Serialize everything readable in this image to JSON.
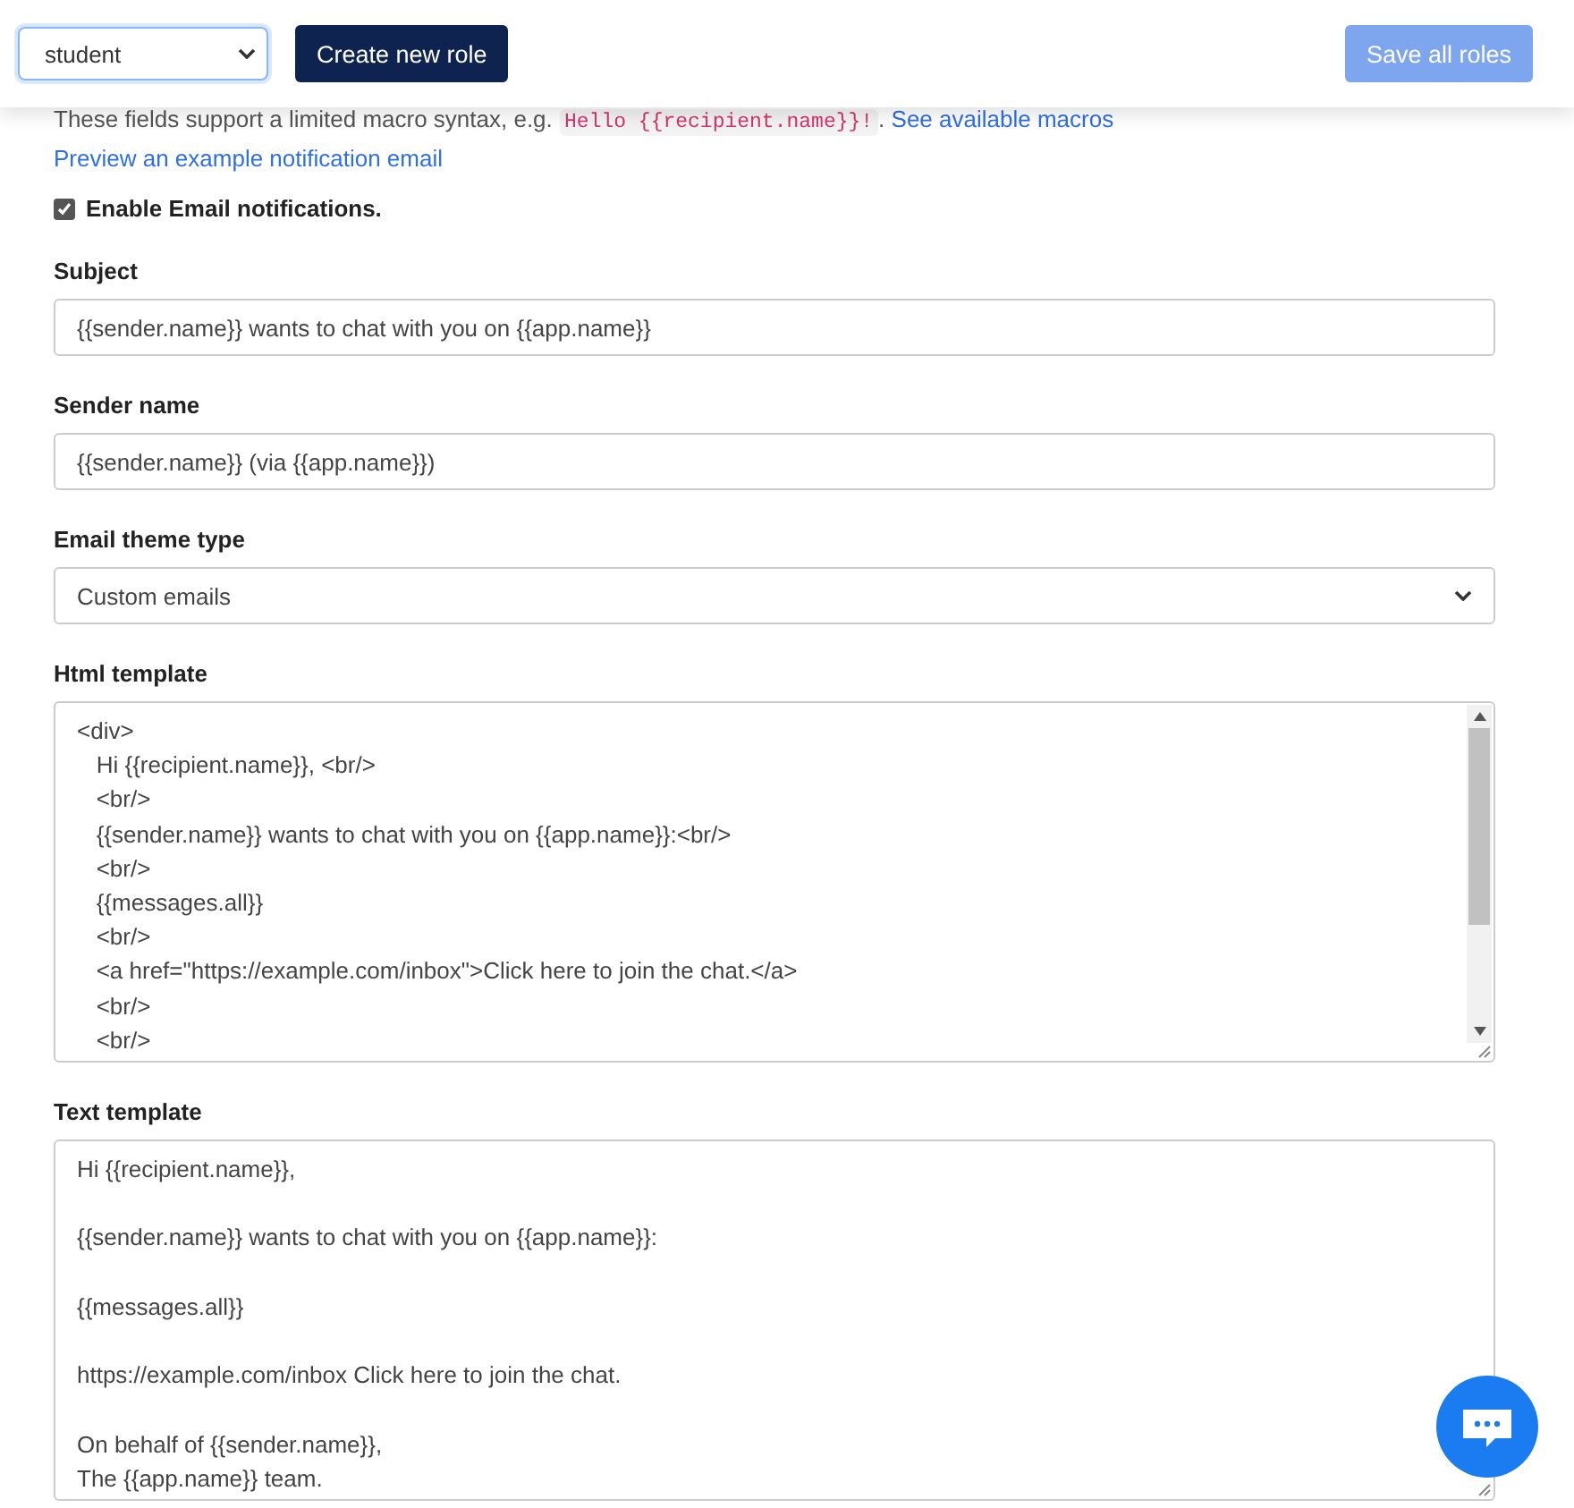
{
  "toolbar": {
    "role_select": {
      "value": "student"
    },
    "create_button": "Create new role",
    "save_button": {
      "label": "Save all roles",
      "disabled": true
    }
  },
  "hint": {
    "text": "These fields support a limited macro syntax, e.g.",
    "code": "Hello {{recipient.name}}!",
    "separator": ".",
    "link": "See available macros"
  },
  "preview_link": "Preview an example notification email",
  "enable_email": {
    "label": "Enable Email notifications.",
    "checked": true
  },
  "fields": [
    {
      "kind": "input",
      "label": "Subject",
      "value": "{{sender.name}} wants to chat with you on {{app.name}}"
    },
    {
      "kind": "input",
      "label": "Sender name",
      "value": "{{sender.name}} (via {{app.name}})"
    },
    {
      "kind": "select",
      "label": "Email theme type",
      "value": "Custom emails"
    },
    {
      "kind": "textarea",
      "label": "Html template",
      "scrollable": true,
      "value": "<div>\n   Hi {{recipient.name}}, <br/>\n   <br/>\n   {{sender.name}} wants to chat with you on {{app.name}}:<br/>\n   <br/>\n   {{messages.all}}\n   <br/>\n   <a href=\"https://example.com/inbox\">Click here to join the chat.</a>\n   <br/>\n   <br/>"
    },
    {
      "kind": "textarea",
      "label": "Text template",
      "scrollable": false,
      "value": "Hi {{recipient.name}},\n\n{{sender.name}} wants to chat with you on {{app.name}}:\n\n{{messages.all}}\n\nhttps://example.com/inbox Click here to join the chat.\n\nOn behalf of {{sender.name}},\nThe {{app.name}} team."
    }
  ]
}
